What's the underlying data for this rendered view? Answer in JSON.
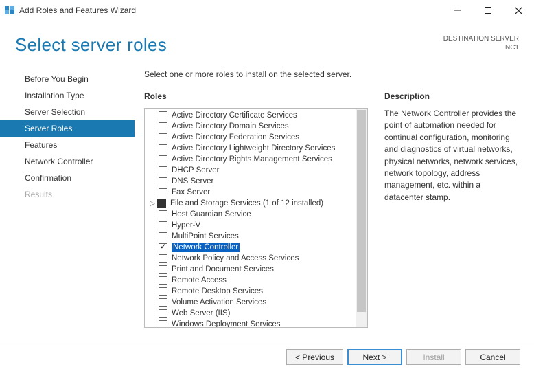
{
  "titlebar": {
    "title": "Add Roles and Features Wizard"
  },
  "header": {
    "heading": "Select server roles",
    "dest_label": "DESTINATION SERVER",
    "dest_value": "NC1"
  },
  "nav": {
    "items": [
      {
        "label": "Before You Begin",
        "state": "normal"
      },
      {
        "label": "Installation Type",
        "state": "normal"
      },
      {
        "label": "Server Selection",
        "state": "normal"
      },
      {
        "label": "Server Roles",
        "state": "selected"
      },
      {
        "label": "Features",
        "state": "normal"
      },
      {
        "label": "Network Controller",
        "state": "normal"
      },
      {
        "label": "Confirmation",
        "state": "normal"
      },
      {
        "label": "Results",
        "state": "disabled"
      }
    ]
  },
  "main": {
    "instruction": "Select one or more roles to install on the selected server.",
    "roles_header": "Roles",
    "desc_header": "Description",
    "description": "The Network Controller provides the point of automation needed for continual configuration, monitoring and diagnostics of virtual networks, physical networks, network services, network topology, address management, etc. within a datacenter stamp.",
    "roles": [
      {
        "label": "Active Directory Certificate Services",
        "checked": false
      },
      {
        "label": "Active Directory Domain Services",
        "checked": false
      },
      {
        "label": "Active Directory Federation Services",
        "checked": false
      },
      {
        "label": "Active Directory Lightweight Directory Services",
        "checked": false
      },
      {
        "label": "Active Directory Rights Management Services",
        "checked": false
      },
      {
        "label": "DHCP Server",
        "checked": false
      },
      {
        "label": "DNS Server",
        "checked": false
      },
      {
        "label": "Fax Server",
        "checked": false
      },
      {
        "label": "File and Storage Services (1 of 12 installed)",
        "checked": "partial",
        "expandable": true
      },
      {
        "label": "Host Guardian Service",
        "checked": false
      },
      {
        "label": "Hyper-V",
        "checked": false
      },
      {
        "label": "MultiPoint Services",
        "checked": false
      },
      {
        "label": "Network Controller",
        "checked": true,
        "selected": true
      },
      {
        "label": "Network Policy and Access Services",
        "checked": false
      },
      {
        "label": "Print and Document Services",
        "checked": false
      },
      {
        "label": "Remote Access",
        "checked": false
      },
      {
        "label": "Remote Desktop Services",
        "checked": false
      },
      {
        "label": "Volume Activation Services",
        "checked": false
      },
      {
        "label": "Web Server (IIS)",
        "checked": false
      },
      {
        "label": "Windows Deployment Services",
        "checked": false
      }
    ]
  },
  "footer": {
    "previous": "< Previous",
    "next": "Next >",
    "install": "Install",
    "cancel": "Cancel"
  }
}
